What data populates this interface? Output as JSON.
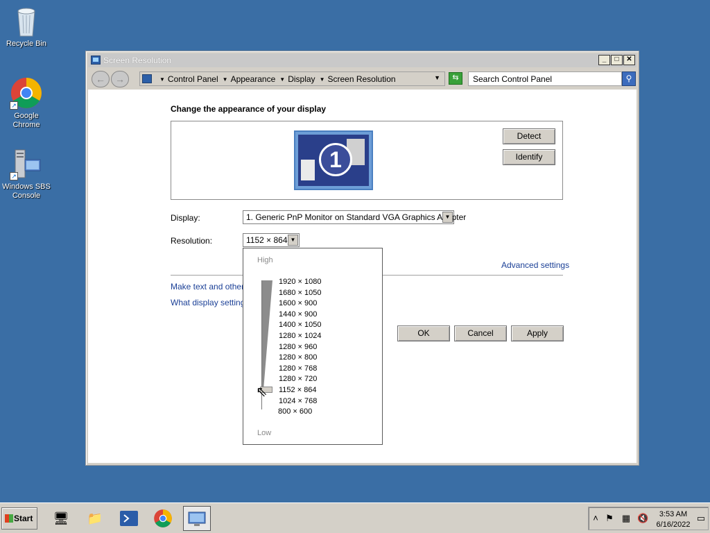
{
  "desktop": {
    "icons": [
      {
        "label": "Recycle Bin",
        "icon": "recycle-bin-icon"
      },
      {
        "label": "Google Chrome",
        "icon": "chrome-icon"
      },
      {
        "label": "Windows SBS Console",
        "icon": "sbs-console-icon"
      }
    ]
  },
  "window": {
    "title": "Screen Resolution",
    "breadcrumbs": [
      "Control Panel",
      "Appearance",
      "Display",
      "Screen Resolution"
    ],
    "search_placeholder": "Search Control Panel",
    "heading": "Change the appearance of your display",
    "monitor_number": "1",
    "detect_label": "Detect",
    "identify_label": "Identify",
    "display_label": "Display:",
    "display_value": "1. Generic PnP Monitor on Standard VGA Graphics Adapter",
    "resolution_label": "Resolution:",
    "resolution_value": "1152 × 864",
    "advanced_link": "Advanced settings",
    "text_link": "Make text and other i",
    "help_link": "What display settings",
    "ok_label": "OK",
    "cancel_label": "Cancel",
    "apply_label": "Apply"
  },
  "resolution_popup": {
    "high_label": "High",
    "low_label": "Low",
    "options": [
      "1920 × 1080",
      "1680 × 1050",
      "1600 × 900",
      "1440 × 900",
      "1400 × 1050",
      "1280 × 1024",
      "1280 × 960",
      "1280 × 800",
      "1280 × 768",
      "1280 × 720",
      "1152 × 864",
      "1024 × 768",
      "800 × 600"
    ],
    "selected": "1152 × 864"
  },
  "taskbar": {
    "start_label": "Start",
    "time": "3:53 AM",
    "date": "6/16/2022"
  }
}
